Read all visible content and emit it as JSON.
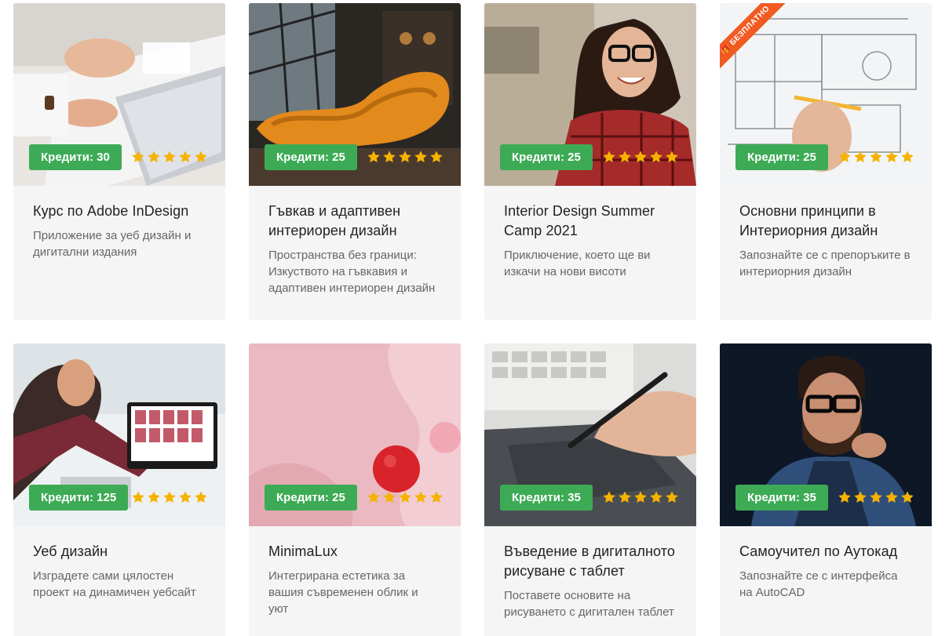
{
  "star_color": "#f5b301",
  "credit_color": "#3dab55",
  "rating_stars": 5,
  "free_badge": "БЕЗПЛАТНО",
  "courses": [
    {
      "credits": "Кредити: 30",
      "title": "Курс по Adobe InDesign",
      "desc": "Приложение за уеб дизайн и дигитални издания"
    },
    {
      "credits": "Кредити: 25",
      "title": "Гъвкав и адаптивен интериорен дизайн",
      "desc": "Пространства без граници: Изкуството на гъвкавия и адаптивен интериорен дизайн"
    },
    {
      "credits": "Кредити: 25",
      "title": "Interior Design Summer Camp 2021",
      "desc": "Приключение, което ще ви изкачи на нови висоти"
    },
    {
      "credits": "Кредити: 25",
      "title": "Основни принципи в Интериорния дизайн",
      "desc": "Запознайте се с препоръките в интериорния дизайн"
    },
    {
      "credits": "Кредити: 125",
      "title": "Уеб дизайн",
      "desc": "Изградете сами цялостен проект на динамичен уебсайт"
    },
    {
      "credits": "Кредити: 25",
      "title": "MinimaLux",
      "desc": "Интегрирана естетика за вашия съвременен облик и уют"
    },
    {
      "credits": "Кредити: 35",
      "title": "Въведение в дигиталното рисуване с таблет",
      "desc": "Поставете основите на рисуването с дигитален таблет"
    },
    {
      "credits": "Кредити: 35",
      "title": "Самоучител по Аутокад",
      "desc": "Запознайте се с интерфейса на AutoCAD"
    }
  ]
}
